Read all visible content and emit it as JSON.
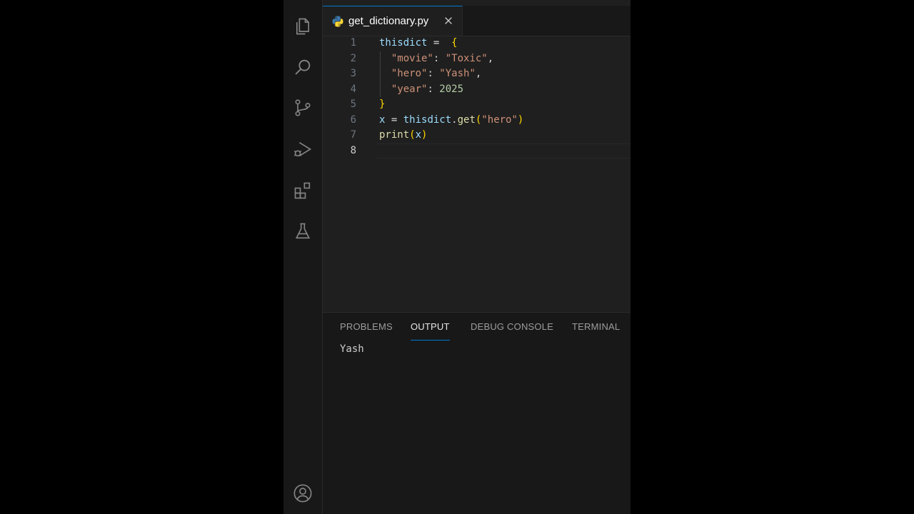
{
  "editor": {
    "tab": {
      "filename": "get_dictionary.py",
      "icon": "python-icon"
    },
    "lines": [
      {
        "n": "1",
        "tokens": [
          [
            "t-var",
            "thisdict"
          ],
          [
            "t-op",
            " = "
          ],
          [
            "t-op",
            " "
          ],
          [
            "t-br",
            "{"
          ]
        ]
      },
      {
        "n": "2",
        "tokens": [
          [
            "t-op",
            "  "
          ],
          [
            "t-str",
            "\"movie\""
          ],
          [
            "t-op",
            ": "
          ],
          [
            "t-str",
            "\"Toxic\""
          ],
          [
            "t-op",
            ","
          ]
        ]
      },
      {
        "n": "3",
        "tokens": [
          [
            "t-op",
            "  "
          ],
          [
            "t-str",
            "\"hero\""
          ],
          [
            "t-op",
            ": "
          ],
          [
            "t-str",
            "\"Yash\""
          ],
          [
            "t-op",
            ","
          ]
        ]
      },
      {
        "n": "4",
        "tokens": [
          [
            "t-op",
            "  "
          ],
          [
            "t-str",
            "\"year\""
          ],
          [
            "t-op",
            ": "
          ],
          [
            "t-num",
            "2025"
          ]
        ]
      },
      {
        "n": "5",
        "tokens": [
          [
            "t-br",
            "}"
          ]
        ]
      },
      {
        "n": "6",
        "tokens": [
          [
            "t-var",
            "x"
          ],
          [
            "t-op",
            " = "
          ],
          [
            "t-var",
            "thisdict"
          ],
          [
            "t-op",
            "."
          ],
          [
            "t-fn",
            "get"
          ],
          [
            "t-br",
            "("
          ],
          [
            "t-str",
            "\"hero\""
          ],
          [
            "t-br",
            ")"
          ]
        ]
      },
      {
        "n": "7",
        "tokens": [
          [
            "t-fn",
            "print"
          ],
          [
            "t-br",
            "("
          ],
          [
            "t-var",
            "x"
          ],
          [
            "t-br",
            ")"
          ]
        ]
      },
      {
        "n": "8",
        "tokens": []
      }
    ],
    "current_line": "8"
  },
  "panel": {
    "tabs": [
      {
        "label": "PROBLEMS",
        "active": false
      },
      {
        "label": "OUTPUT",
        "active": true
      },
      {
        "label": "DEBUG CONSOLE",
        "active": false
      },
      {
        "label": "TERMINAL",
        "active": false
      }
    ],
    "output": "Yash"
  },
  "activity_bar": {
    "items": [
      "files-icon",
      "search-icon",
      "source-control-icon",
      "run-debug-icon",
      "extensions-icon",
      "testing-icon"
    ],
    "bottom": [
      "account-icon"
    ]
  },
  "colors": {
    "accent": "#0078d4",
    "background": "#1f1f1f",
    "sidebar": "#181818"
  }
}
